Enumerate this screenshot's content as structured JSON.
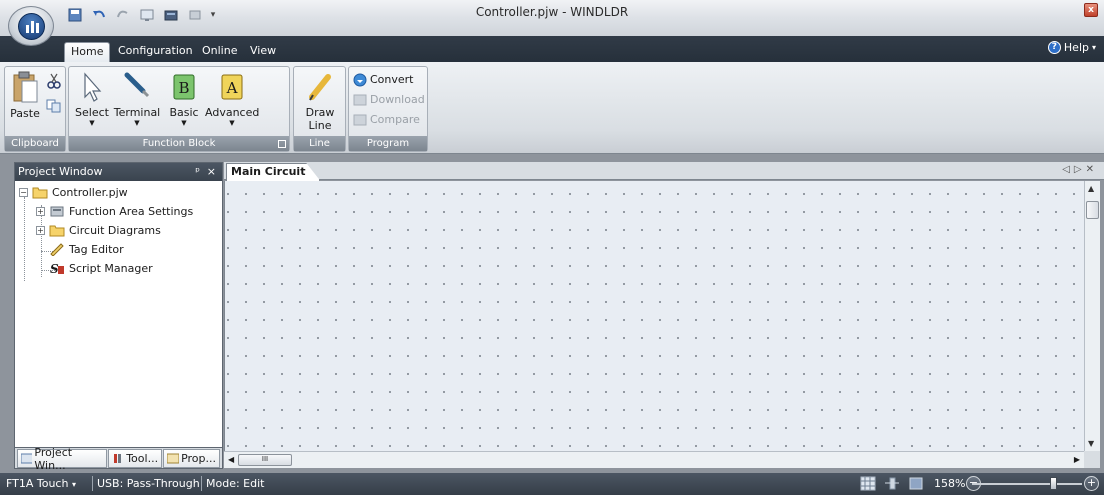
{
  "window": {
    "title": "Controller.pjw - WINDLDR"
  },
  "ribbon_tabs": [
    {
      "label": "Home",
      "active": true
    },
    {
      "label": "Configuration",
      "active": false
    },
    {
      "label": "Online",
      "active": false
    },
    {
      "label": "View",
      "active": false
    }
  ],
  "help_label": "Help",
  "groups": {
    "clipboard": {
      "label": "Clipboard",
      "paste": "Paste"
    },
    "function_block": {
      "label": "Function Block",
      "select": "Select",
      "terminal": "Terminal",
      "basic": "Basic",
      "advanced": "Advanced",
      "basic_letter": "B",
      "advanced_letter": "A"
    },
    "line": {
      "label": "Line",
      "draw_line_1": "Draw",
      "draw_line_2": "Line"
    },
    "program": {
      "label": "Program",
      "convert": "Convert",
      "download": "Download",
      "compare": "Compare"
    }
  },
  "project_window": {
    "title": "Project Window",
    "tree": {
      "root": "Controller.pjw",
      "items": [
        "Function Area Settings",
        "Circuit Diagrams",
        "Tag Editor",
        "Script Manager"
      ]
    },
    "bottom_tabs": [
      "Project Win...",
      "Tool...",
      "Prop..."
    ]
  },
  "document": {
    "tab": "Main Circuit"
  },
  "status_bar": {
    "device": "FT1A Touch",
    "connection": "USB: Pass-Through",
    "mode": "Mode: Edit",
    "zoom": "158%"
  },
  "colors": {
    "ribbon_tab_bg": "#313b47",
    "canvas_bg": "#e8edf3",
    "status_bg": "#4c5663"
  }
}
